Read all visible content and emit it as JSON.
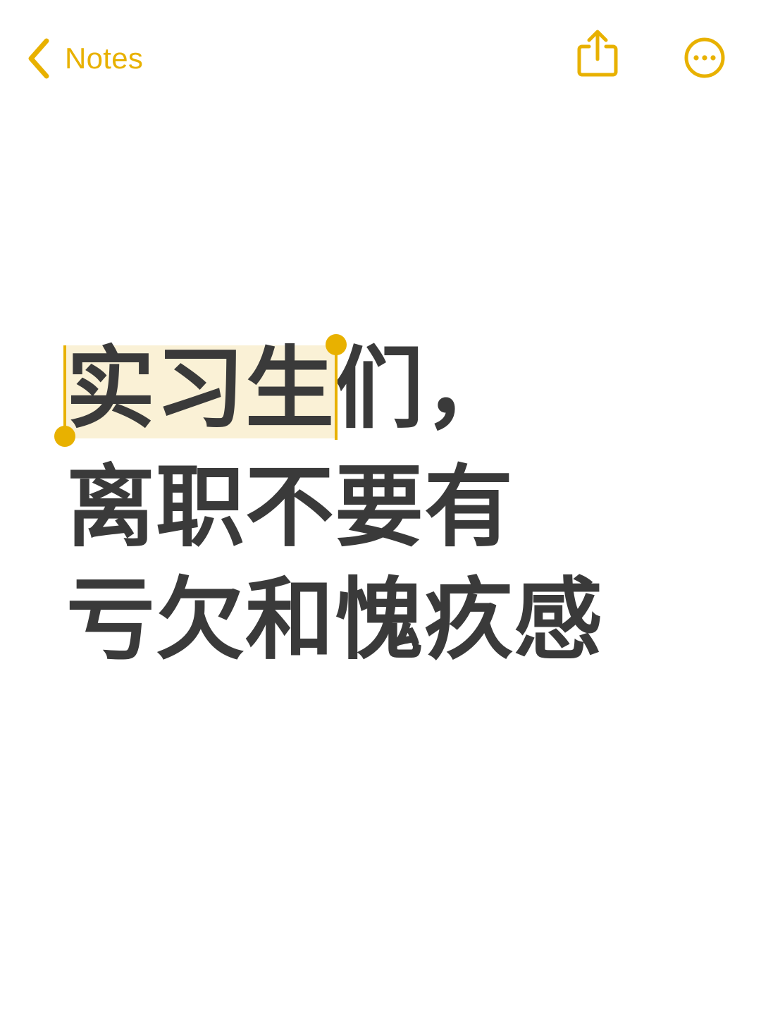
{
  "nav": {
    "back_label": "Notes",
    "back_icon": "chevron-left-icon",
    "share_icon": "share-icon",
    "more_icon": "ellipsis-circle-icon"
  },
  "note": {
    "line1_selected": "实习生",
    "line1_rest": "们，",
    "line2": "离职不要有",
    "line3": "亏欠和愧疚感"
  },
  "colors": {
    "accent": "#E8B100",
    "text": "#3a3a3a",
    "selection": "#FAF1D6"
  }
}
